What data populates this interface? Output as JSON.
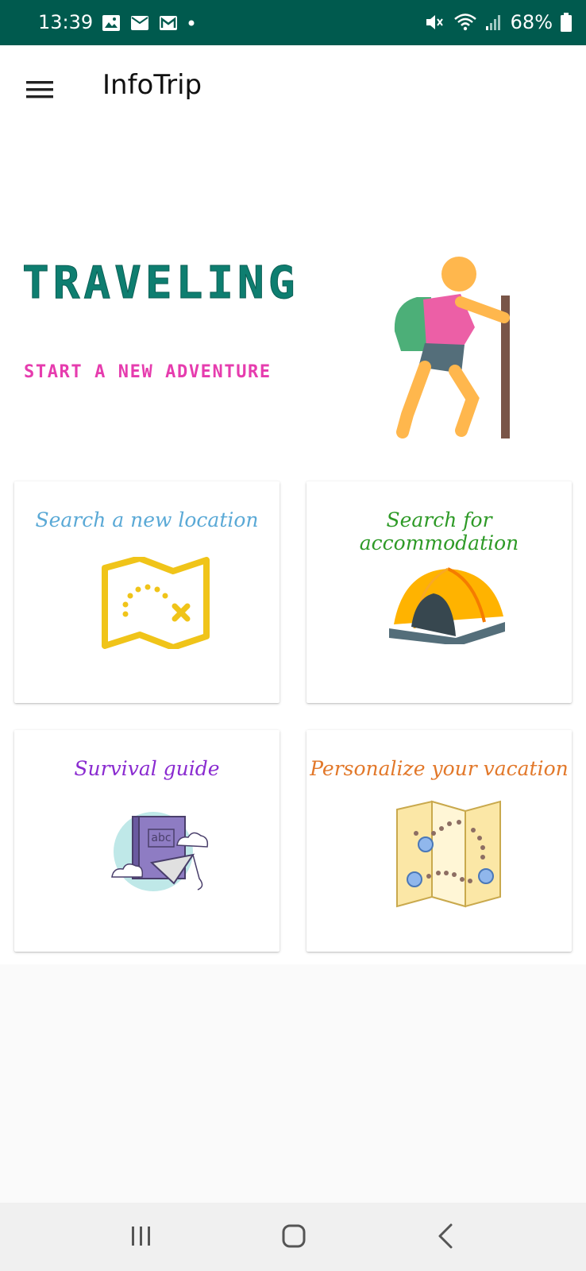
{
  "status_bar": {
    "time": "13:39",
    "battery": "68%",
    "icons": [
      "image-icon",
      "message-icon",
      "gmail-icon",
      "dot-icon",
      "mute-icon",
      "wifi-icon",
      "signal-icon",
      "battery-icon"
    ]
  },
  "app_bar": {
    "title": "InfoTrip",
    "menu_icon": "hamburger-menu-icon"
  },
  "hero": {
    "title": "TRAVELING",
    "subtitle": "START A NEW ADVENTURE",
    "illustration": "hiker-icon"
  },
  "cards": [
    {
      "label": "Search a new location",
      "color": "#5aa9d6",
      "icon": "treasure-map-icon"
    },
    {
      "label": "Search for accommodation",
      "color": "#2e9a27",
      "icon": "tent-icon"
    },
    {
      "label": "Survival guide",
      "color": "#8a2bd0",
      "icon": "guide-book-icon"
    },
    {
      "label": "Personalize your vacation",
      "color": "#e2782a",
      "icon": "route-map-icon"
    }
  ],
  "nav_bar": {
    "icons": [
      "recent-apps-icon",
      "home-icon",
      "back-icon"
    ]
  },
  "colors": {
    "status_bar": "#005a4e",
    "hero_title": "#0e7e70",
    "hero_subtitle": "#e63cae"
  }
}
